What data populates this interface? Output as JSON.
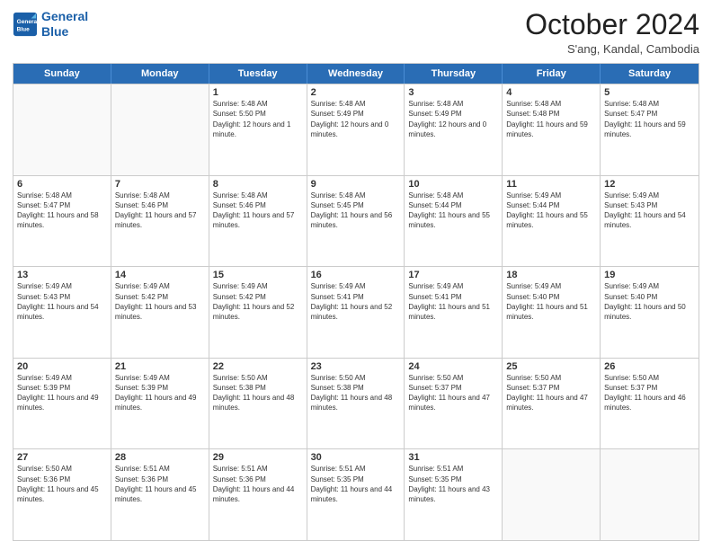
{
  "header": {
    "logo_line1": "General",
    "logo_line2": "Blue",
    "month": "October 2024",
    "location": "S'ang, Kandal, Cambodia"
  },
  "days_of_week": [
    "Sunday",
    "Monday",
    "Tuesday",
    "Wednesday",
    "Thursday",
    "Friday",
    "Saturday"
  ],
  "weeks": [
    [
      {
        "day": "",
        "text": "",
        "empty": true
      },
      {
        "day": "",
        "text": "",
        "empty": true
      },
      {
        "day": "1",
        "text": "Sunrise: 5:48 AM\nSunset: 5:50 PM\nDaylight: 12 hours and 1 minute."
      },
      {
        "day": "2",
        "text": "Sunrise: 5:48 AM\nSunset: 5:49 PM\nDaylight: 12 hours and 0 minutes."
      },
      {
        "day": "3",
        "text": "Sunrise: 5:48 AM\nSunset: 5:49 PM\nDaylight: 12 hours and 0 minutes."
      },
      {
        "day": "4",
        "text": "Sunrise: 5:48 AM\nSunset: 5:48 PM\nDaylight: 11 hours and 59 minutes."
      },
      {
        "day": "5",
        "text": "Sunrise: 5:48 AM\nSunset: 5:47 PM\nDaylight: 11 hours and 59 minutes."
      }
    ],
    [
      {
        "day": "6",
        "text": "Sunrise: 5:48 AM\nSunset: 5:47 PM\nDaylight: 11 hours and 58 minutes."
      },
      {
        "day": "7",
        "text": "Sunrise: 5:48 AM\nSunset: 5:46 PM\nDaylight: 11 hours and 57 minutes."
      },
      {
        "day": "8",
        "text": "Sunrise: 5:48 AM\nSunset: 5:46 PM\nDaylight: 11 hours and 57 minutes."
      },
      {
        "day": "9",
        "text": "Sunrise: 5:48 AM\nSunset: 5:45 PM\nDaylight: 11 hours and 56 minutes."
      },
      {
        "day": "10",
        "text": "Sunrise: 5:48 AM\nSunset: 5:44 PM\nDaylight: 11 hours and 55 minutes."
      },
      {
        "day": "11",
        "text": "Sunrise: 5:49 AM\nSunset: 5:44 PM\nDaylight: 11 hours and 55 minutes."
      },
      {
        "day": "12",
        "text": "Sunrise: 5:49 AM\nSunset: 5:43 PM\nDaylight: 11 hours and 54 minutes."
      }
    ],
    [
      {
        "day": "13",
        "text": "Sunrise: 5:49 AM\nSunset: 5:43 PM\nDaylight: 11 hours and 54 minutes."
      },
      {
        "day": "14",
        "text": "Sunrise: 5:49 AM\nSunset: 5:42 PM\nDaylight: 11 hours and 53 minutes."
      },
      {
        "day": "15",
        "text": "Sunrise: 5:49 AM\nSunset: 5:42 PM\nDaylight: 11 hours and 52 minutes."
      },
      {
        "day": "16",
        "text": "Sunrise: 5:49 AM\nSunset: 5:41 PM\nDaylight: 11 hours and 52 minutes."
      },
      {
        "day": "17",
        "text": "Sunrise: 5:49 AM\nSunset: 5:41 PM\nDaylight: 11 hours and 51 minutes."
      },
      {
        "day": "18",
        "text": "Sunrise: 5:49 AM\nSunset: 5:40 PM\nDaylight: 11 hours and 51 minutes."
      },
      {
        "day": "19",
        "text": "Sunrise: 5:49 AM\nSunset: 5:40 PM\nDaylight: 11 hours and 50 minutes."
      }
    ],
    [
      {
        "day": "20",
        "text": "Sunrise: 5:49 AM\nSunset: 5:39 PM\nDaylight: 11 hours and 49 minutes."
      },
      {
        "day": "21",
        "text": "Sunrise: 5:49 AM\nSunset: 5:39 PM\nDaylight: 11 hours and 49 minutes."
      },
      {
        "day": "22",
        "text": "Sunrise: 5:50 AM\nSunset: 5:38 PM\nDaylight: 11 hours and 48 minutes."
      },
      {
        "day": "23",
        "text": "Sunrise: 5:50 AM\nSunset: 5:38 PM\nDaylight: 11 hours and 48 minutes."
      },
      {
        "day": "24",
        "text": "Sunrise: 5:50 AM\nSunset: 5:37 PM\nDaylight: 11 hours and 47 minutes."
      },
      {
        "day": "25",
        "text": "Sunrise: 5:50 AM\nSunset: 5:37 PM\nDaylight: 11 hours and 47 minutes."
      },
      {
        "day": "26",
        "text": "Sunrise: 5:50 AM\nSunset: 5:37 PM\nDaylight: 11 hours and 46 minutes."
      }
    ],
    [
      {
        "day": "27",
        "text": "Sunrise: 5:50 AM\nSunset: 5:36 PM\nDaylight: 11 hours and 45 minutes."
      },
      {
        "day": "28",
        "text": "Sunrise: 5:51 AM\nSunset: 5:36 PM\nDaylight: 11 hours and 45 minutes."
      },
      {
        "day": "29",
        "text": "Sunrise: 5:51 AM\nSunset: 5:36 PM\nDaylight: 11 hours and 44 minutes."
      },
      {
        "day": "30",
        "text": "Sunrise: 5:51 AM\nSunset: 5:35 PM\nDaylight: 11 hours and 44 minutes."
      },
      {
        "day": "31",
        "text": "Sunrise: 5:51 AM\nSunset: 5:35 PM\nDaylight: 11 hours and 43 minutes."
      },
      {
        "day": "",
        "text": "",
        "empty": true
      },
      {
        "day": "",
        "text": "",
        "empty": true
      }
    ]
  ]
}
